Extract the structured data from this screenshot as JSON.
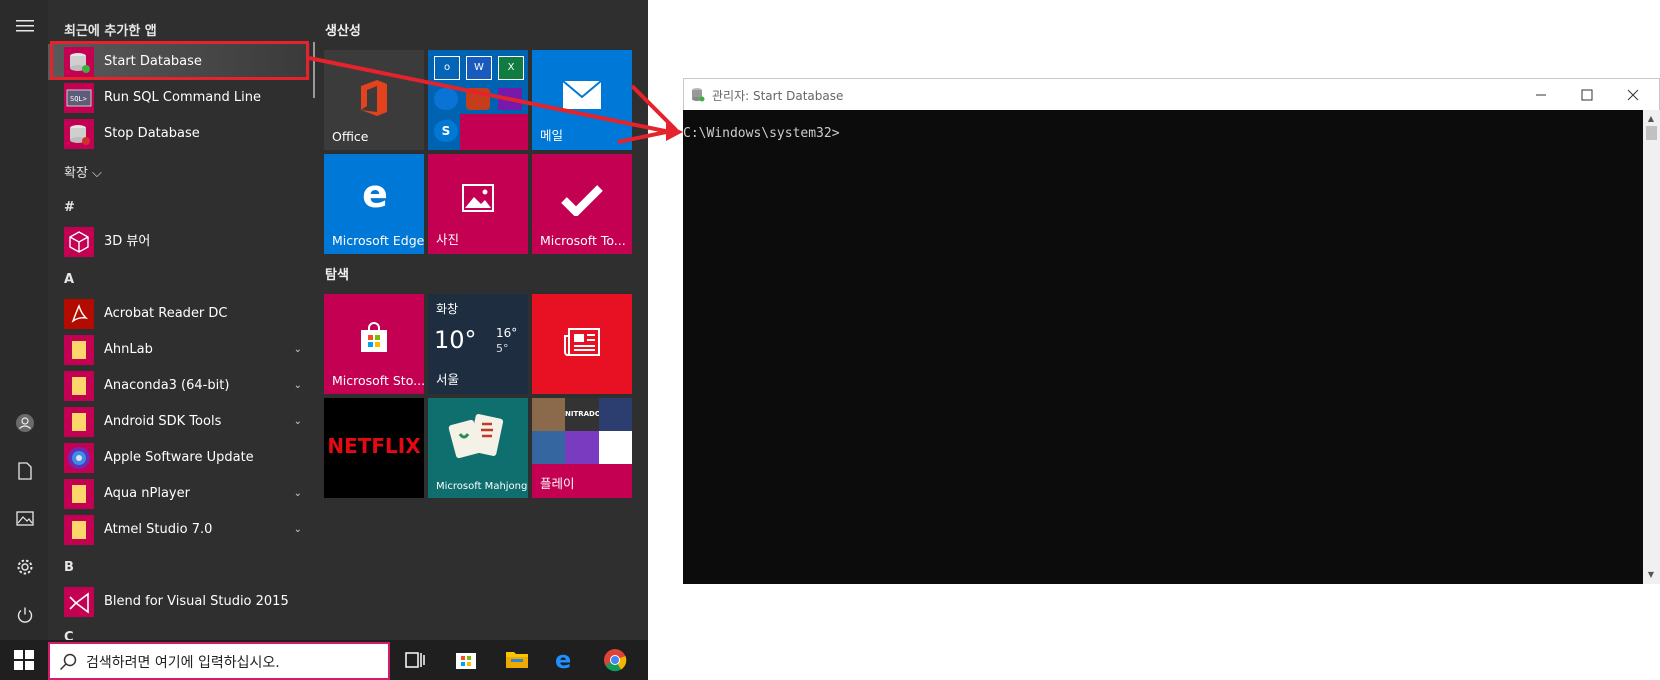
{
  "start_menu": {
    "header_recent": "최근에 추가한 앱",
    "recent_apps": [
      {
        "label": "Start Database",
        "icon": "database-start-icon"
      },
      {
        "label": "Run SQL Command Line",
        "icon": "sql-command-icon"
      },
      {
        "label": "Stop Database",
        "icon": "database-stop-icon"
      }
    ],
    "expand_label": "확장 ⌵",
    "sections": [
      {
        "header": "#",
        "apps": [
          {
            "label": "3D 뷰어",
            "icon": "3d-cube-icon"
          }
        ]
      },
      {
        "header": "A",
        "apps": [
          {
            "label": "Acrobat Reader DC",
            "icon": "acrobat-icon"
          },
          {
            "label": "AhnLab",
            "icon": "folder-icon",
            "expandable": true
          },
          {
            "label": "Anaconda3 (64-bit)",
            "icon": "folder-icon",
            "expandable": true
          },
          {
            "label": "Android SDK Tools",
            "icon": "folder-icon",
            "expandable": true
          },
          {
            "label": "Apple Software Update",
            "icon": "apple-update-icon"
          },
          {
            "label": "Aqua nPlayer",
            "icon": "folder-icon",
            "expandable": true
          },
          {
            "label": "Atmel Studio 7.0",
            "icon": "folder-icon",
            "expandable": true
          }
        ]
      },
      {
        "header": "B",
        "apps": [
          {
            "label": "Blend for Visual Studio 2015",
            "icon": "blend-vs-icon"
          }
        ]
      },
      {
        "header": "C",
        "apps": []
      }
    ],
    "chevron": "⌄"
  },
  "tiles": {
    "group_productivity": "생산성",
    "group_explore": "탐색",
    "office": "Office",
    "mail": "메일",
    "edge": "Microsoft Edge",
    "photos": "사진",
    "todo": "Microsoft To...",
    "store": "Microsoft Sto...",
    "weather": {
      "condition": "화창",
      "temp": "10°",
      "high": "16°",
      "low": "5°",
      "city": "서울"
    },
    "netflix": "NETFLIX",
    "mahjong": "Microsoft Mahjong",
    "play": "플레이",
    "nitrado": "NITRADO"
  },
  "taskbar": {
    "search_placeholder": "검색하려면 여기에 입력하십시오."
  },
  "console": {
    "title": "관리자: Start Database",
    "prompt": "C:\\Windows\\system32>"
  },
  "colors": {
    "tile_magenta": "#c30052",
    "tile_blue": "#0078d7",
    "highlight_red": "#e4232c"
  }
}
